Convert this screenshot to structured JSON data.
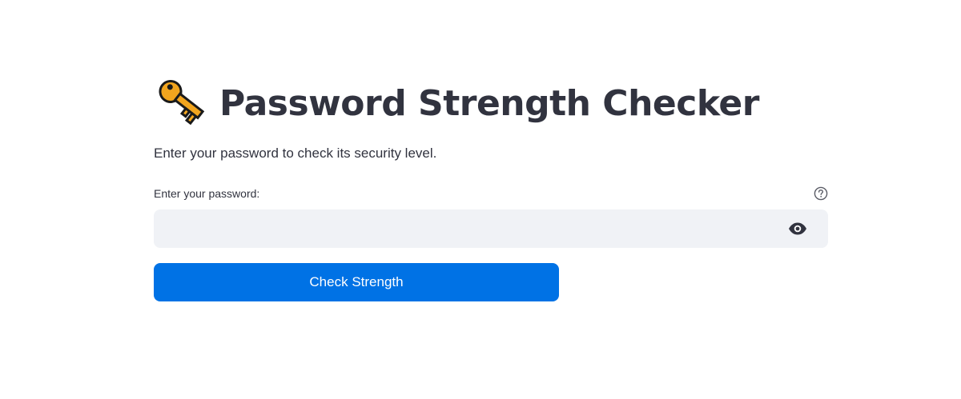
{
  "page": {
    "title": "Password Strength Checker",
    "title_icon": "key-icon",
    "subtitle": "Enter your password to check its security level."
  },
  "password_field": {
    "label": "Enter your password:",
    "value": "",
    "placeholder": "",
    "help_icon": "question-circle-icon",
    "visibility_icon": "eye-icon"
  },
  "check_button": {
    "label": "Check Strength"
  },
  "colors": {
    "text": "#31333f",
    "input_background": "#f0f2f6",
    "button_background": "#0072e5",
    "button_text": "#ffffff",
    "key_gold": "#f0a020"
  }
}
